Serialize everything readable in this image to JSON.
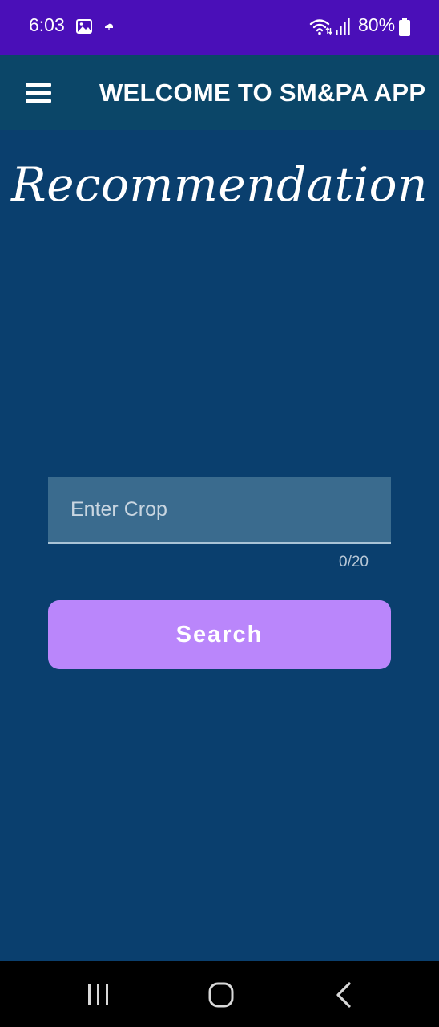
{
  "status_bar": {
    "time": "6:03",
    "battery_percent": "80%",
    "icons": [
      "gallery-icon",
      "cloud-icon",
      "wifi-icon",
      "signal-icon",
      "battery-icon"
    ],
    "background_color": "#4a0fb8"
  },
  "app_bar": {
    "title": "WELCOME TO SM&PA APP",
    "menu_icon": "hamburger-menu-icon",
    "background_color": "#0b4668"
  },
  "main": {
    "heading": "Recommendation",
    "crop_input": {
      "placeholder": "Enter Crop",
      "value": "",
      "counter": "0/20"
    },
    "search_button_label": "Search",
    "accent_color": "#ba86fb",
    "background_color": "#0a3f6e"
  },
  "nav_bar": {
    "icons": [
      "recents-icon",
      "home-icon",
      "back-icon"
    ]
  }
}
